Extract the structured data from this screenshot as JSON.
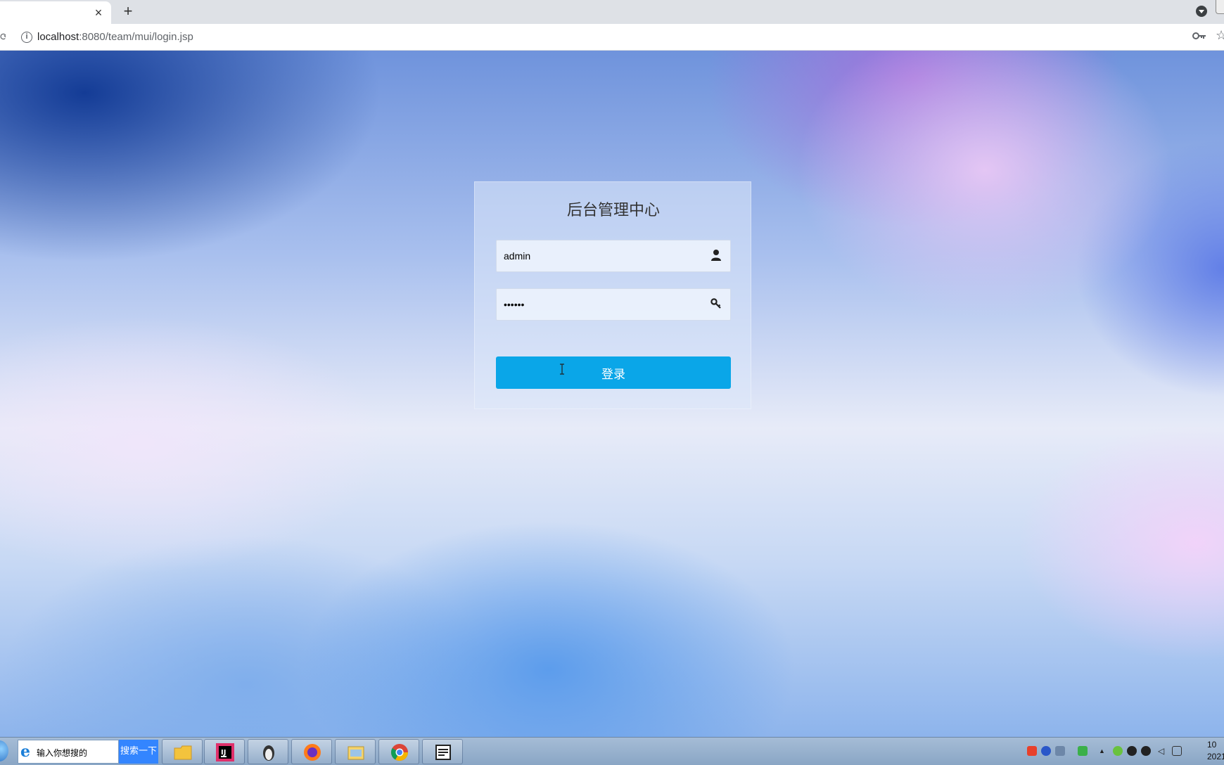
{
  "browser": {
    "tab_close_glyph": "×",
    "new_tab_glyph": "+",
    "url_host": "localhost",
    "url_path": ":8080/team/mui/login.jsp"
  },
  "login": {
    "title": "后台管理中心",
    "username_value": "admin",
    "password_value": "••••••",
    "submit_label": "登录"
  },
  "taskbar": {
    "search_placeholder": "输入你想搜的",
    "search_button": "搜索一下",
    "apps": [
      "folder-icon",
      "intellij-icon",
      "penguin-icon",
      "firefox-icon",
      "file-explorer-icon",
      "chrome-icon",
      "tool-icon"
    ],
    "clock_time": "10",
    "clock_date": "2021"
  },
  "colors": {
    "button": "#0aa6e8",
    "taskbar": "#8aa6c5"
  }
}
